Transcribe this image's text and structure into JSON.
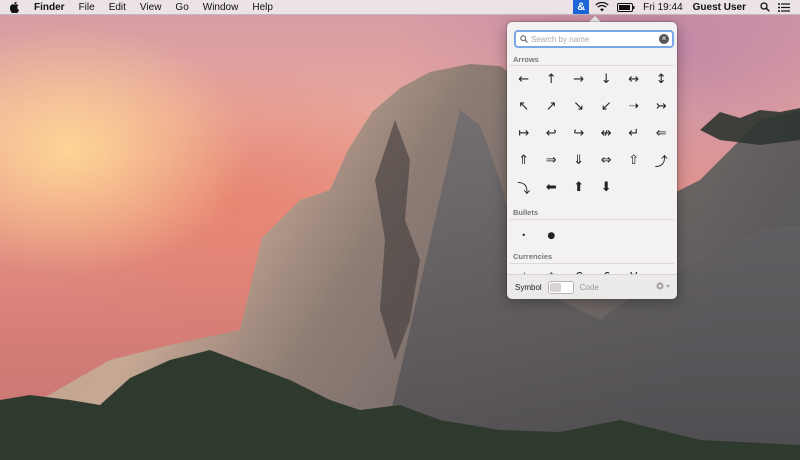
{
  "menubar": {
    "app_name": "Finder",
    "menus": [
      "File",
      "Edit",
      "View",
      "Go",
      "Window",
      "Help"
    ],
    "charviewer_label": "&",
    "clock": "Fri 19:44",
    "user": "Guest User"
  },
  "character_viewer": {
    "search_placeholder": "Search by name",
    "sections": {
      "arrows": "Arrows",
      "bullets": "Bullets",
      "currencies": "Currencies"
    },
    "arrows": [
      "←",
      "↑",
      "→",
      "↓",
      "↔",
      "↕",
      "↖",
      "↗",
      "↘",
      "↙",
      "➝",
      "↣",
      "↦",
      "↩",
      "↪",
      "↮",
      "↵",
      "⇐",
      "⇑",
      "⇒",
      "⇓",
      "⇔",
      "⇧",
      "⤴",
      "⤵",
      "⬅",
      "⬆",
      "⬇"
    ],
    "bullets": [
      "•",
      "●"
    ],
    "currencies_partial": [
      "¢",
      "$",
      "€",
      "£",
      "¥",
      "₩"
    ],
    "footer": {
      "symbol_label": "Symbol",
      "code_label": "Code"
    }
  }
}
